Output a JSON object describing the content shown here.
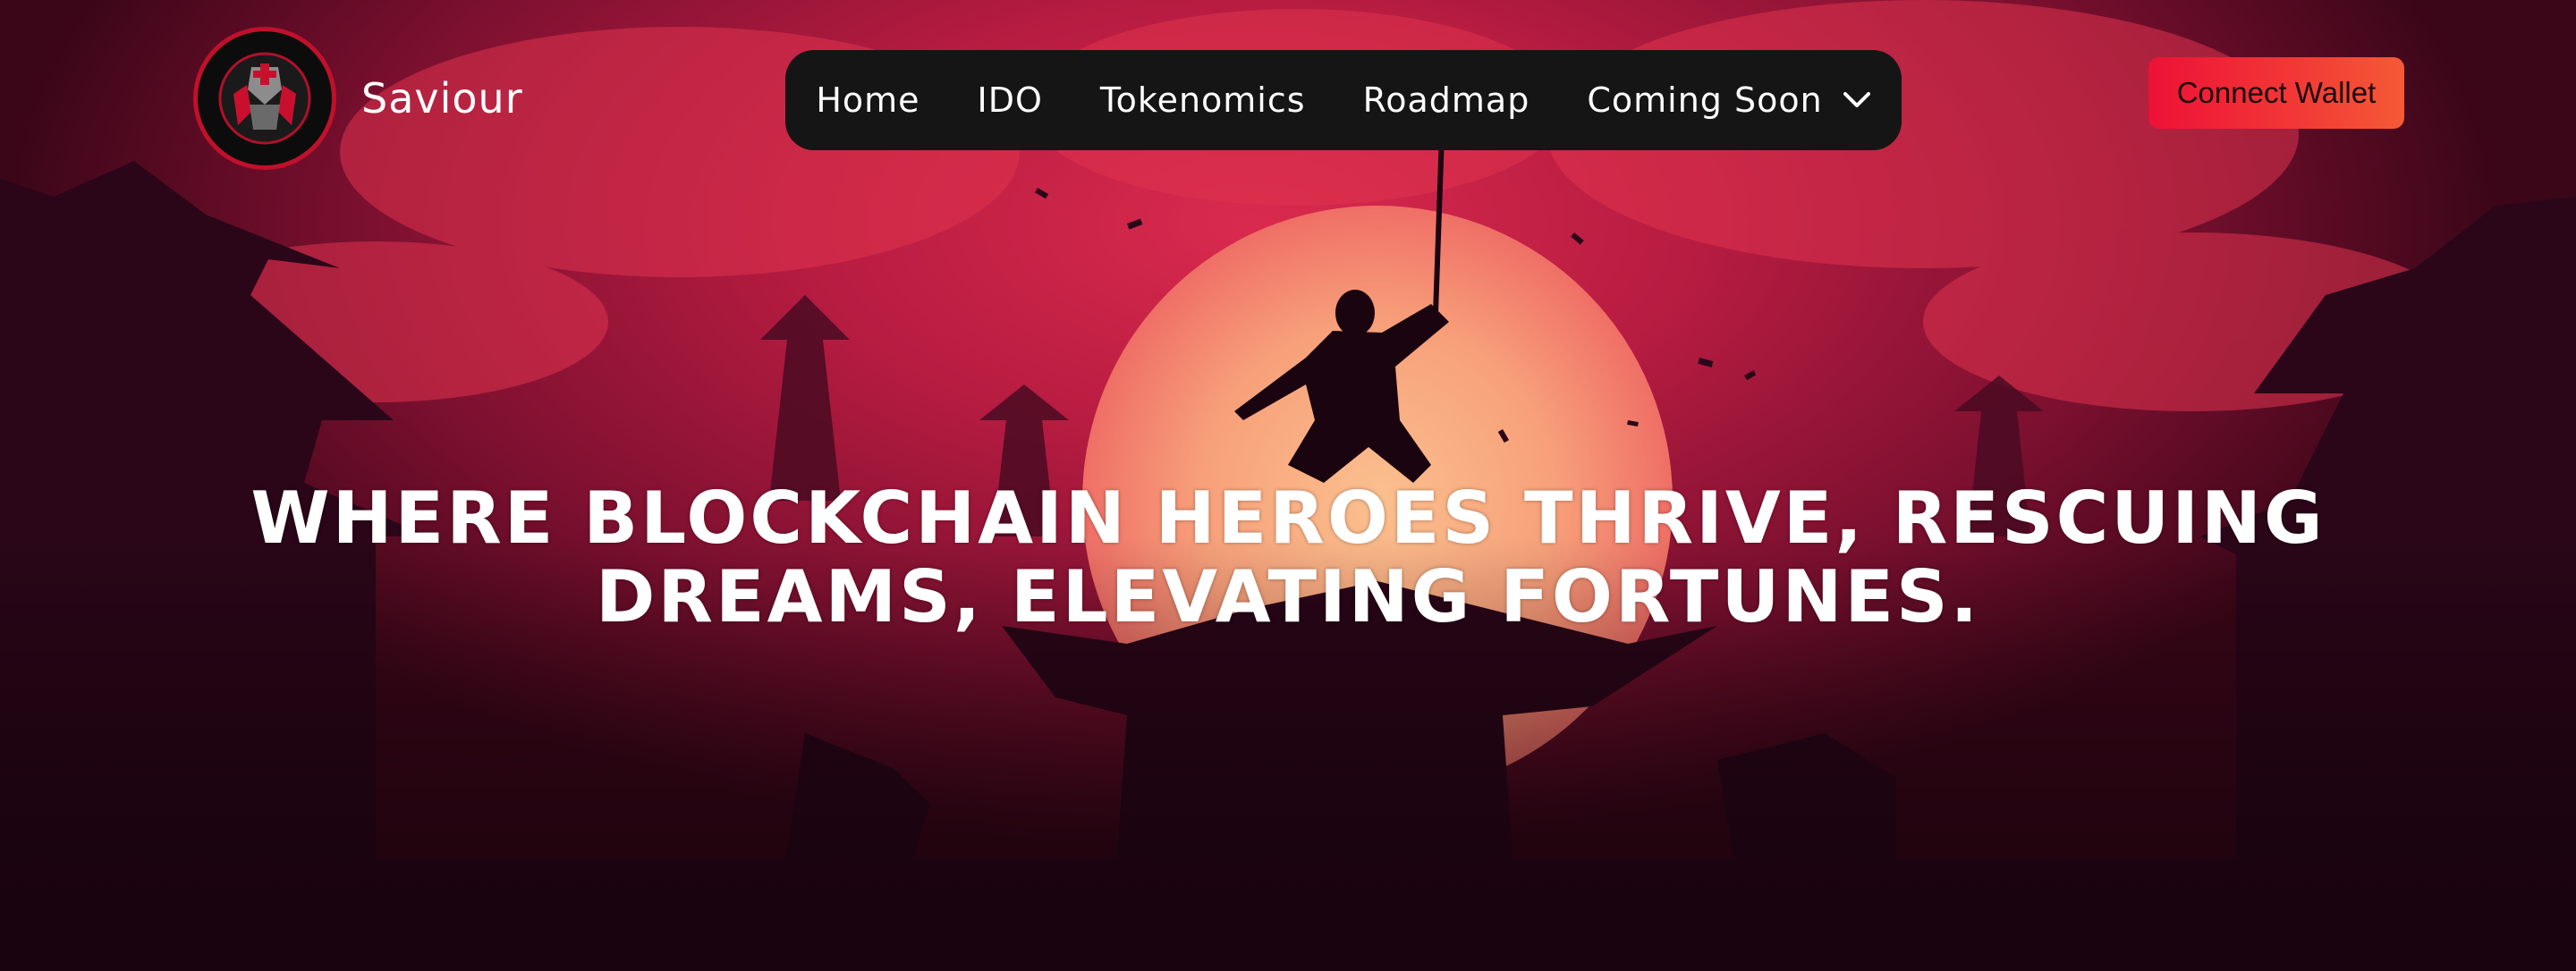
{
  "brand": {
    "name": "Saviour",
    "logo_icon": "samurai-mask-icon"
  },
  "nav": {
    "items": [
      {
        "label": "Home"
      },
      {
        "label": "IDO"
      },
      {
        "label": "Tokenomics"
      },
      {
        "label": "Roadmap"
      },
      {
        "label": "Coming Soon",
        "icon": "chevron-down-icon"
      }
    ]
  },
  "actions": {
    "connect_label": "Connect Wallet"
  },
  "hero": {
    "headline_line1": "WHERE BLOCKCHAIN HEROES THRIVE, RESCUING",
    "headline_line2": "DREAMS, ELEVATING FORTUNES."
  },
  "colors": {
    "nav_bg": "#151515",
    "accent": "#ee1136",
    "accent_end": "#f55a36",
    "sky": "#b81c41",
    "sun": "#f7a07a",
    "silhouette": "#260616"
  }
}
